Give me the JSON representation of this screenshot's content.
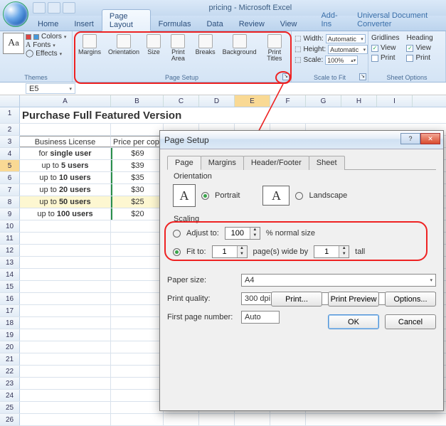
{
  "app": {
    "title": "pricing - Microsoft Excel"
  },
  "tabs": [
    "Home",
    "Insert",
    "Page Layout",
    "Formulas",
    "Data",
    "Review",
    "View",
    "Add-Ins",
    "Universal Document Converter"
  ],
  "active_tab": 2,
  "ribbon": {
    "themes": {
      "label": "Themes",
      "colors": "Colors",
      "fonts": "Fonts",
      "effects": "Effects"
    },
    "page_setup": {
      "label": "Page Setup",
      "margins": "Margins",
      "orientation": "Orientation",
      "size": "Size",
      "print_area": "Print\nArea",
      "breaks": "Breaks",
      "background": "Background",
      "print_titles": "Print\nTitles"
    },
    "scale": {
      "label": "Scale to Fit",
      "width_l": "Width:",
      "width_v": "Automatic",
      "height_l": "Height:",
      "height_v": "Automatic",
      "scale_l": "Scale:",
      "scale_v": "100%"
    },
    "sheet": {
      "label": "Sheet Options",
      "gridlines": "Gridlines",
      "headings": "Heading",
      "view": "View",
      "print": "Print"
    }
  },
  "namebox": "E5",
  "columns": [
    "A",
    "B",
    "C",
    "D",
    "E",
    "F",
    "G",
    "H",
    "I"
  ],
  "sheet": {
    "title": "Purchase Full Featured Version",
    "header": [
      "Business License",
      "Price per copy"
    ],
    "rows": [
      {
        "a": "for single user",
        "b": "$69",
        "bold": "single user"
      },
      {
        "a": "up to 5 users",
        "b": "$39",
        "bold": "5 users"
      },
      {
        "a": "up to 10 users",
        "b": "$35",
        "bold": "10 users"
      },
      {
        "a": "up to 20 users",
        "b": "$30",
        "bold": "20 users"
      },
      {
        "a": "up to 50 users",
        "b": "$25",
        "bold": "50 users"
      },
      {
        "a": "up to 100 users",
        "b": "$20",
        "bold": "100 users"
      }
    ]
  },
  "dialog": {
    "title": "Page Setup",
    "tabs": [
      "Page",
      "Margins",
      "Header/Footer",
      "Sheet"
    ],
    "orientation_label": "Orientation",
    "portrait": "Portrait",
    "landscape": "Landscape",
    "scaling_label": "Scaling",
    "adjust_to": "Adjust to:",
    "adjust_val": "100",
    "adjust_suffix": "% normal size",
    "fit_to": "Fit to:",
    "fit_w": "1",
    "fit_mid": "page(s) wide by",
    "fit_h": "1",
    "fit_suffix": "tall",
    "paper_l": "Paper size:",
    "paper_v": "A4",
    "quality_l": "Print quality:",
    "quality_v": "300 dpi",
    "firstpg_l": "First page number:",
    "firstpg_v": "Auto",
    "btn_print": "Print...",
    "btn_preview": "Print Preview",
    "btn_options": "Options...",
    "btn_ok": "OK",
    "btn_cancel": "Cancel"
  },
  "chart_data": {
    "type": "table",
    "title": "Purchase Full Featured Version",
    "columns": [
      "Business License",
      "Price per copy"
    ],
    "rows": [
      [
        "for single user",
        69
      ],
      [
        "up to 5 users",
        39
      ],
      [
        "up to 10 users",
        35
      ],
      [
        "up to 20 users",
        30
      ],
      [
        "up to 50 users",
        25
      ],
      [
        "up to 100 users",
        20
      ]
    ]
  }
}
